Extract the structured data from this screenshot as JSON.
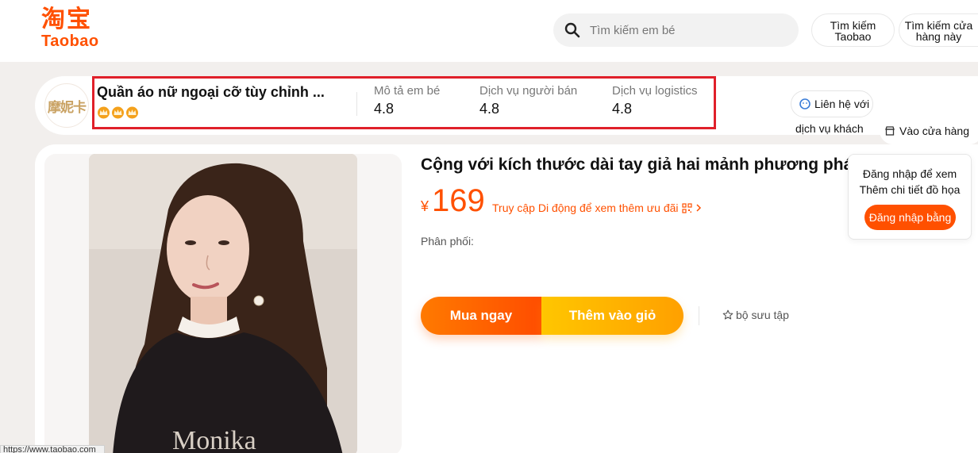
{
  "header": {
    "logo_cn": "淘宝",
    "logo_en": "Taobao",
    "search_placeholder": "Tìm kiếm em bé",
    "search_taobao_label": "Tìm kiếm Taobao",
    "search_store_label": "Tìm kiếm cửa hàng này"
  },
  "shop": {
    "logo_text": "摩妮卡",
    "name": "Quần áo nữ ngoại cỡ tùy chỉnh ...",
    "crown_count": 3,
    "scores": [
      {
        "label": "Mô tả em bé",
        "value": "4.8"
      },
      {
        "label": "Dịch vụ người bán",
        "value": "4.8"
      },
      {
        "label": "Dịch vụ logistics",
        "value": "4.8"
      }
    ],
    "contact_label": "Liên hệ với",
    "contact_sub": "dịch vụ khách",
    "store_label": "Vào cửa hàng"
  },
  "product": {
    "title": "Cộng với kích thước dài tay giả hai mảnh phương pháp",
    "currency": "¥",
    "price": "169",
    "promo": "Truy cập Di động để xem thêm ưu đãi",
    "distribution_label": "Phân phối:",
    "buy_label": "Mua ngay",
    "cart_label": "Thêm vào giỏ",
    "collect_label": "bộ sưu tập",
    "photo_text": "Monika"
  },
  "login_popup": {
    "line1": "Đăng nhập để xem",
    "line2": "Thêm chi tiết đồ họa",
    "button_label": "Đăng nhập bằng"
  },
  "status_bar": {
    "url": "https://www.taobao.com"
  },
  "colors": {
    "brand": "#ff5000",
    "highlight": "#e0202a",
    "buy_gradient_start": "#ff7a00",
    "cart_gradient_start": "#ffc600"
  },
  "icons": {
    "search": "search-icon",
    "contact": "headset-icon",
    "store": "store-icon",
    "qr": "qr-code-icon",
    "chevron": "chevron-right-icon",
    "star": "star-icon",
    "crown": "crown-icon"
  }
}
